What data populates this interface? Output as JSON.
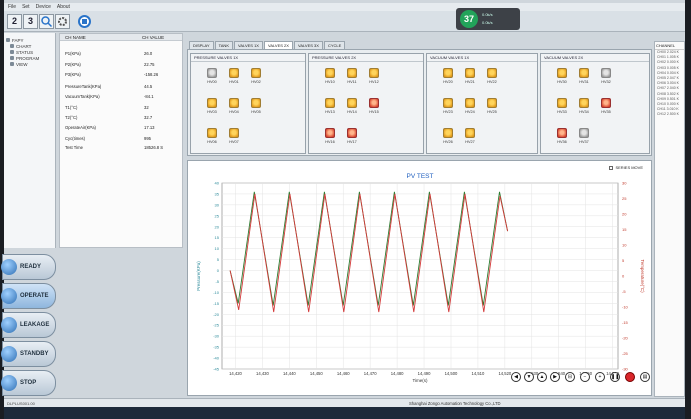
{
  "menu": [
    "File",
    "Set",
    "Device",
    "About"
  ],
  "toolbar": {
    "btn1": "2",
    "btn2": "3"
  },
  "tray": {
    "badge": "37",
    "line1": "0.0k/s",
    "line2": "0.0k/s"
  },
  "nav": [
    "FAPY",
    "CHART",
    "STATUS",
    "PROGRAM",
    "VIEW"
  ],
  "status": {
    "col_name": "CH NAME",
    "col_value": "CH VALUE",
    "rows": [
      {
        "label": "P1(KPa)",
        "value": "26.0"
      },
      {
        "label": "P2(KPa)",
        "value": "22.75"
      },
      {
        "label": "P3(KPa)",
        "value": "-158.26"
      },
      {
        "label": "PressureTank(KPa)",
        "value": "44.5"
      },
      {
        "label": "VacuumTank(KPa)",
        "value": "-84.1"
      },
      {
        "label": "T1(°C)",
        "value": "32"
      },
      {
        "label": "T2(°C)",
        "value": "32.7"
      },
      {
        "label": "OperateAir(KPa)",
        "value": "17.13"
      },
      {
        "label": "Cyc(times)",
        "value": "995"
      },
      {
        "label": "Test Time",
        "value": "18526.8 S"
      }
    ]
  },
  "modes": [
    "READY",
    "OPERATE",
    "LEAKAGE",
    "STANDBY",
    "STOP"
  ],
  "tabs": [
    "DISPLAY",
    "TANK",
    "VALVES 1X",
    "VALVES 2X",
    "VALVES 3X",
    "CYCLE"
  ],
  "valve_groups": [
    {
      "title": "PRESSURE VALVES 1X",
      "valves": [
        {
          "label": "HV00",
          "state": "gray"
        },
        {
          "label": "HV01",
          "state": "on"
        },
        {
          "label": "HV02",
          "state": "on"
        },
        {
          "label": "HV03",
          "state": "on"
        },
        {
          "label": "HV04",
          "state": "on"
        },
        {
          "label": "HV05",
          "state": "on"
        },
        {
          "label": "HV06",
          "state": "on"
        },
        {
          "label": "HV07",
          "state": "on"
        }
      ]
    },
    {
      "title": "PRESSURE VALVES 2X",
      "valves": [
        {
          "label": "HV10",
          "state": "on"
        },
        {
          "label": "HV11",
          "state": "on"
        },
        {
          "label": "HV12",
          "state": "on"
        },
        {
          "label": "HV13",
          "state": "on"
        },
        {
          "label": "HV14",
          "state": "on"
        },
        {
          "label": "HV15",
          "state": "red"
        },
        {
          "label": "HV16",
          "state": "red"
        },
        {
          "label": "HV17",
          "state": "red"
        }
      ]
    },
    {
      "title": "VACUUM VALVES 1X",
      "valves": [
        {
          "label": "HV20",
          "state": "on"
        },
        {
          "label": "HV21",
          "state": "on"
        },
        {
          "label": "HV22",
          "state": "on"
        },
        {
          "label": "HV23",
          "state": "on"
        },
        {
          "label": "HV24",
          "state": "on"
        },
        {
          "label": "HV25",
          "state": "on"
        },
        {
          "label": "HV26",
          "state": "on"
        },
        {
          "label": "HV27",
          "state": "on"
        }
      ]
    },
    {
      "title": "VACUUM VALVES 2X",
      "valves": [
        {
          "label": "HV30",
          "state": "on"
        },
        {
          "label": "HV31",
          "state": "on"
        },
        {
          "label": "HV32",
          "state": "gray"
        },
        {
          "label": "HV33",
          "state": "on"
        },
        {
          "label": "HV34",
          "state": "on"
        },
        {
          "label": "HV35",
          "state": "red"
        },
        {
          "label": "HV36",
          "state": "red"
        },
        {
          "label": "HV37",
          "state": "gray"
        }
      ]
    }
  ],
  "series_mode": "SERIES MOVE",
  "channel": {
    "title": "CHANNEL",
    "rows": [
      "CH00 2.024 K",
      "CH01 1.005 K",
      "CH02 0.000 K",
      "CH03 0.005 K",
      "CH04 0.004 K",
      "CH05 2.047 K",
      "CH06 3.004 K",
      "CH07 2.040 K",
      "CH08 3.502 K",
      "CH09 0.501 K",
      "CH10 0.000 K",
      "CH11 3.010 K",
      "CH12 2.500 K"
    ]
  },
  "bottombar": {
    "left": "DLPLUS001.00",
    "company": "Shanghai Zongo  Automation Technology Co.,LTD"
  },
  "chart_data": {
    "type": "line",
    "title": "PV TEST",
    "xlabel": "Time(s)",
    "ylabel": "Pressure(KPa)",
    "y2label": "Temperature(°C)",
    "xlim": [
      14415,
      14562
    ],
    "ylim": [
      -45,
      40
    ],
    "y2lim": [
      -30,
      30
    ],
    "xticks": [
      "14,420",
      "14,430",
      "14,440",
      "14,450",
      "14,460",
      "14,470",
      "14,480",
      "14,490",
      "14,500",
      "14,510",
      "14,520",
      "14,530",
      "14,540",
      "14,550",
      "14,560"
    ],
    "yticks": [
      -45,
      -40,
      -35,
      -30,
      -25,
      -20,
      -15,
      -10,
      -5,
      0,
      5,
      10,
      15,
      20,
      25,
      30,
      35,
      40
    ],
    "y2ticks": [
      -30,
      -25,
      -20,
      -15,
      -10,
      -5,
      0,
      5,
      10,
      15,
      20,
      25,
      30
    ],
    "series": [
      {
        "color": "#2e7d32",
        "points": [
          [
            14418,
            0
          ],
          [
            14421,
            -15
          ],
          [
            14427,
            36
          ],
          [
            14434,
            -16
          ],
          [
            14440,
            36
          ],
          [
            14447,
            -16
          ],
          [
            14453,
            36
          ],
          [
            14460,
            -16
          ],
          [
            14466,
            36
          ],
          [
            14473,
            -16
          ],
          [
            14479,
            36
          ],
          [
            14486,
            -16
          ],
          [
            14492,
            36
          ],
          [
            14499,
            -16
          ],
          [
            14505,
            36
          ],
          [
            14512,
            -16
          ],
          [
            14518,
            36
          ],
          [
            14521,
            18
          ]
        ]
      },
      {
        "color": "#d33a3a",
        "points": [
          [
            14418,
            0
          ],
          [
            14421.2,
            -18
          ],
          [
            14427.2,
            35
          ],
          [
            14434.2,
            -19
          ],
          [
            14440.2,
            35
          ],
          [
            14447.2,
            -19
          ],
          [
            14453.2,
            35
          ],
          [
            14460.2,
            -19
          ],
          [
            14466.2,
            35
          ],
          [
            14473.2,
            -19
          ],
          [
            14479.2,
            35
          ],
          [
            14486.2,
            -19
          ],
          [
            14492.2,
            35
          ],
          [
            14499.2,
            -19
          ],
          [
            14505.2,
            35
          ],
          [
            14512.2,
            -19
          ],
          [
            14518.2,
            34
          ],
          [
            14521,
            18
          ]
        ]
      }
    ]
  }
}
